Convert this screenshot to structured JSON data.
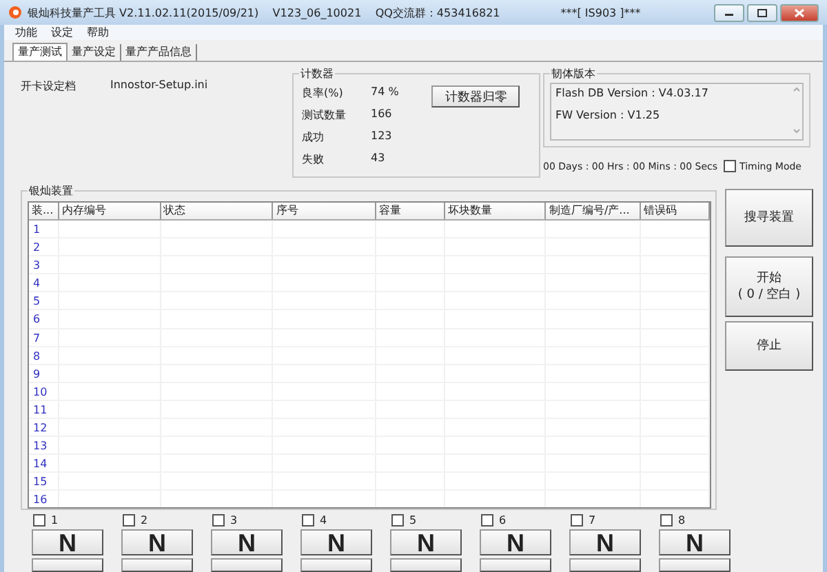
{
  "window": {
    "title": "银灿科技量产工具 V2.11.02.11(2015/09/21)    V123_06_10021    QQ交流群：453416821",
    "subtitle": "***[ IS903 ]***"
  },
  "menu": [
    "功能",
    "设定",
    "帮助"
  ],
  "tabs": [
    {
      "label": "量产测试",
      "selected": true
    },
    {
      "label": "量产设定",
      "selected": false
    },
    {
      "label": "量产产品信息",
      "selected": false
    }
  ],
  "settings_file": {
    "label": "开卡设定档",
    "value": "Innostor-Setup.ini"
  },
  "counter": {
    "title": "计数器",
    "rows": [
      {
        "label": "良率(%)",
        "value": "74 %"
      },
      {
        "label": "测试数量",
        "value": "166"
      },
      {
        "label": "成功",
        "value": "123"
      },
      {
        "label": "失败",
        "value": "43"
      }
    ],
    "reset_button": "计数器归零"
  },
  "firmware": {
    "title": "韧体版本",
    "lines": [
      "Flash DB Version :  V4.03.17",
      "FW Version :   V1.25"
    ]
  },
  "timer": "00 Days : 00 Hrs : 00 Mins : 00 Secs",
  "timing_mode": {
    "label": "Timing Mode",
    "checked": false
  },
  "devices": {
    "title": "银灿装置",
    "columns": [
      "装...",
      "内存编号",
      "状态",
      "序号",
      "容量",
      "坏块数量",
      "制造厂编号/产...",
      "错误码"
    ],
    "rows": [
      "1",
      "2",
      "3",
      "4",
      "5",
      "6",
      "7",
      "8",
      "9",
      "10",
      "11",
      "12",
      "13",
      "14",
      "15",
      "16"
    ]
  },
  "buttons": [
    {
      "label": "搜寻装置"
    },
    {
      "label": "开始\n( 0 / 空白 )"
    },
    {
      "label": "停止"
    }
  ],
  "slots": [
    {
      "label": "1",
      "checked": false,
      "status": "N"
    },
    {
      "label": "2",
      "checked": false,
      "status": "N"
    },
    {
      "label": "3",
      "checked": false,
      "status": "N"
    },
    {
      "label": "4",
      "checked": false,
      "status": "N"
    },
    {
      "label": "5",
      "checked": false,
      "status": "N"
    },
    {
      "label": "6",
      "checked": false,
      "status": "N"
    },
    {
      "label": "7",
      "checked": false,
      "status": "N"
    },
    {
      "label": "8",
      "checked": false,
      "status": "N"
    }
  ]
}
